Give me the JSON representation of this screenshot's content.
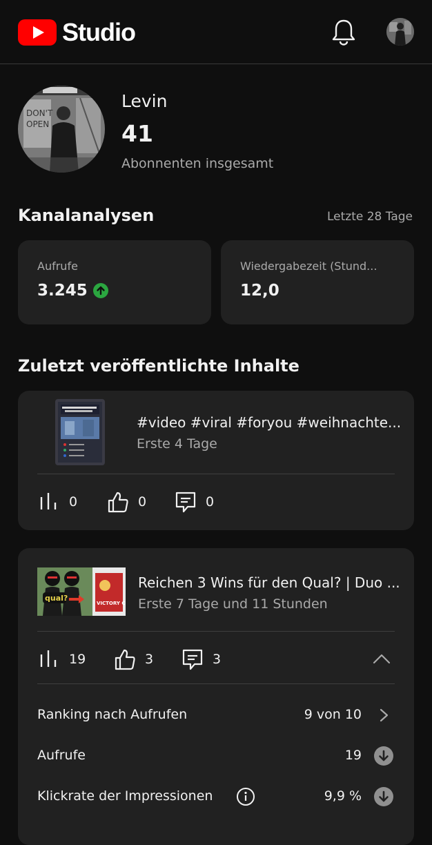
{
  "header": {
    "app_name": "Studio",
    "icons": [
      "youtube-logo",
      "bell-icon",
      "account-avatar"
    ]
  },
  "channel": {
    "name": "Levin",
    "subscribers": "41",
    "subscribers_label": "Abonnenten insgesamt"
  },
  "analytics": {
    "title": "Kanalanalysen",
    "period": "Letzte 28 Tage",
    "views_label": "Aufrufe",
    "views_value": "3.245",
    "views_trend": "up",
    "watch_label": "Wiedergabezeit (Stund...",
    "watch_value": "12,0"
  },
  "recent": {
    "title": "Zuletzt veröffentlichte Inhalte",
    "items": [
      {
        "title": "#video #viral #foryou #weihnachte...",
        "period": "Erste 4 Tage",
        "views": "0",
        "likes": "0",
        "comments": "0"
      },
      {
        "title": "Reichen 3 Wins für den Qual? | Duo ...",
        "period": "Erste 7 Tage und 11 Stunden",
        "views": "19",
        "likes": "3",
        "comments": "3",
        "details": {
          "ranking_label": "Ranking nach Aufrufen",
          "ranking_value": "9 von 10",
          "views_label": "Aufrufe",
          "views_value": "19",
          "ctr_label": "Klickrate der Impressionen",
          "ctr_value": "9,9 %"
        }
      }
    ]
  },
  "colors": {
    "background": "#0f0f0f",
    "card": "#212121",
    "youtube_red": "#ff0000",
    "positive": "#2ba640",
    "negative_badge": "#909090"
  }
}
